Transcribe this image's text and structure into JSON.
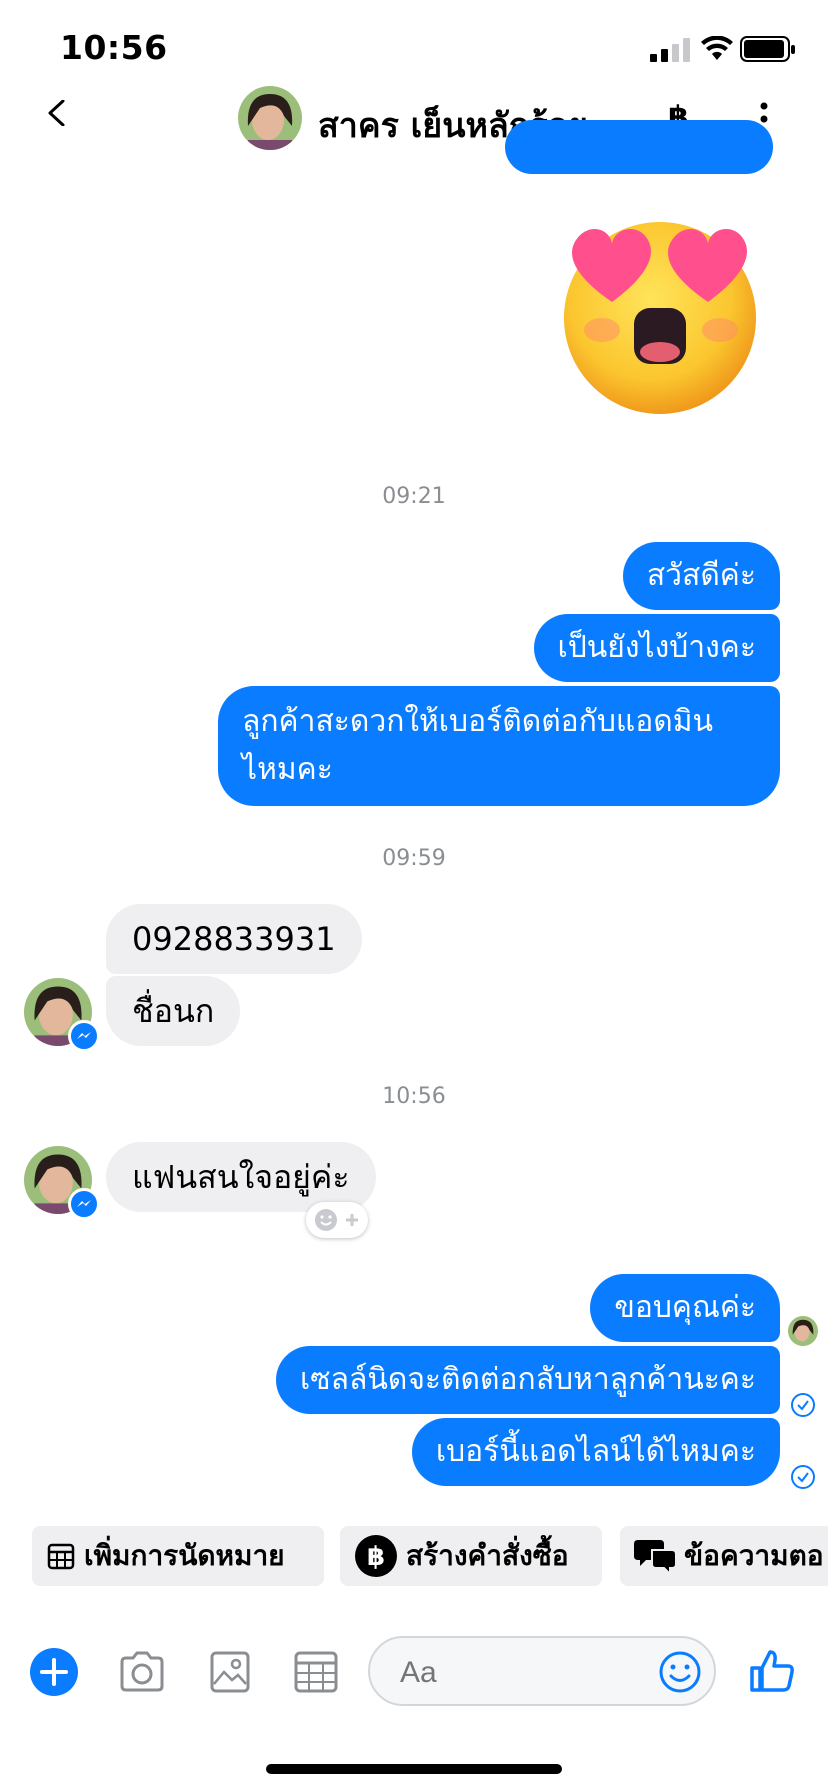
{
  "status_bar": {
    "time": "10:56"
  },
  "header": {
    "contact_name": "สาคร เย็นหลักร้อย",
    "currency_symbol": "฿"
  },
  "timestamps": [
    "09:21",
    "09:59",
    "10:56"
  ],
  "outgoing_group_1": [
    {
      "text": "สวัสดีค่ะ"
    },
    {
      "text": "เป็นยังไงบ้างคะ"
    },
    {
      "text_line1": "ลูกค้าสะดวกให้เบอร์ติดต่อกับแอดมิน",
      "text_line2": "ไหมคะ"
    }
  ],
  "incoming_group_1": [
    {
      "text": "0928833931"
    },
    {
      "text": "ชื่อนก"
    }
  ],
  "incoming_group_2": [
    {
      "text": "แฟนสนใจอยู่ค่ะ"
    }
  ],
  "outgoing_group_2": [
    {
      "text": "ขอบคุณค่ะ"
    },
    {
      "text": "เซลล์นิดจะติดต่อกลับหาลูกค้านะคะ"
    },
    {
      "text": "เบอร์นี้แอดไลน์ได้ไหมคะ"
    }
  ],
  "quick_actions": [
    {
      "label": "เพิ่มการนัดหมาย",
      "icon": "calendar-icon"
    },
    {
      "label": "สร้างคำสั่งซื้อ",
      "icon": "baht-icon"
    },
    {
      "label": "ข้อความตอ",
      "icon": "chat-bubbles-icon"
    }
  ],
  "composer": {
    "placeholder": "Aa"
  },
  "colors": {
    "accent": "#0a7cff",
    "incoming_bubble": "#efeff1",
    "timestamp": "#8a8d91"
  }
}
